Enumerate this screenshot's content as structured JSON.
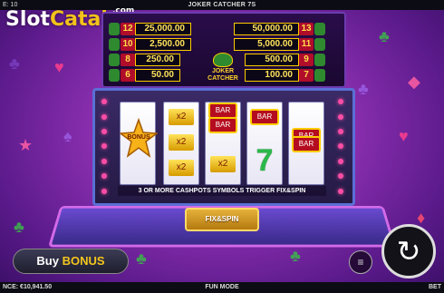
{
  "topbar": {
    "left": "E: 10",
    "title": "JOKER CATCHER 7S"
  },
  "logo": {
    "slot": "Slot",
    "catalog": "Catalog",
    "com": ".com"
  },
  "paytable": {
    "left": [
      {
        "num": "12",
        "value": "25,000.00"
      },
      {
        "num": "10",
        "value": "2,500.00"
      },
      {
        "num": "8",
        "value": "250.00"
      },
      {
        "num": "6",
        "value": "50.00"
      }
    ],
    "right": [
      {
        "num": "13",
        "value": "50,000.00"
      },
      {
        "num": "11",
        "value": "5,000.00"
      },
      {
        "num": "9",
        "value": "500.00"
      },
      {
        "num": "7",
        "value": "100.00"
      }
    ],
    "logo_line1": "JOKER",
    "logo_line2": "CATCHER"
  },
  "reels": {
    "bonus_label": "BONUS",
    "x2": "x2",
    "bar": "BAR"
  },
  "info_strip": "3 OR MORE CASHPOTS SYMBOLS TRIGGER FIX&SPIN",
  "fixspin_label": "FIX&SPIN",
  "buy_bonus": {
    "buy": "Buy",
    "bonus": "BONUS"
  },
  "bottombar": {
    "balance": "NCE: €10,941.50",
    "mode": "FUN MODE",
    "bet": "BET"
  },
  "icons": {
    "spin": "spin-arrow-icon",
    "stack": "coin-stack-icon"
  }
}
